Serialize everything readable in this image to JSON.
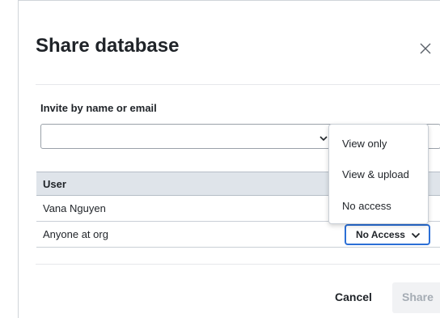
{
  "dialog": {
    "title": "Share database",
    "invite_label": "Invite by name or email",
    "invite_placeholder": "",
    "table": {
      "header_user": "User",
      "rows": [
        {
          "name": "Vana Nguyen"
        },
        {
          "name": "Anyone at org",
          "access": "No Access"
        }
      ]
    },
    "actions": {
      "cancel_label": "Cancel",
      "share_label": "Share"
    }
  },
  "dropdown": {
    "options": [
      "View only",
      "View & upload",
      "No access"
    ]
  }
}
